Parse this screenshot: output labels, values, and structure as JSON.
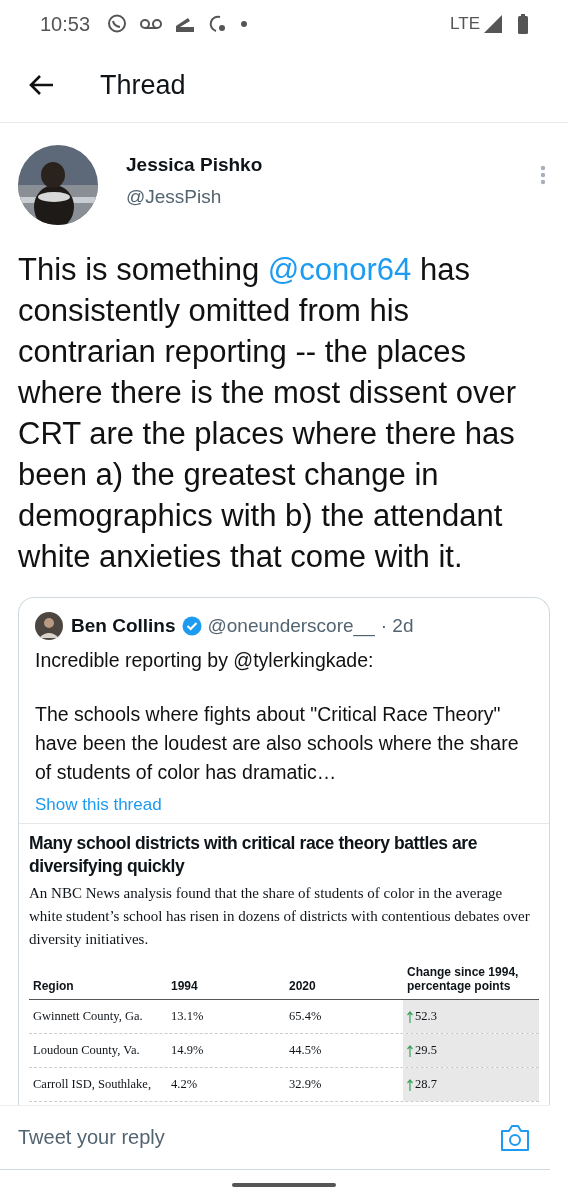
{
  "status_bar": {
    "time": "10:53",
    "network": "LTE"
  },
  "header": {
    "title": "Thread"
  },
  "tweet": {
    "name": "Jessica Pishko",
    "handle": "@JessPish",
    "text": [
      {
        "kind": "plain",
        "text": "This is something "
      },
      {
        "kind": "mention",
        "text": "@conor64"
      },
      {
        "kind": "plain",
        "text": " has consistently omitted from his contrarian reporting -- the places where there is the most dissent over CRT are the places where there has been a) the greatest change in demographics with b) the attendant white anxieties that come with it."
      }
    ],
    "quote": {
      "name": "Ben Collins",
      "verified": true,
      "handle": "@oneunderscore__",
      "time": "· 2d",
      "paragraphs": [
        "Incredible reporting by @tylerkingkade:",
        "The schools where fights about \"Critical Race Theory\" have been the loudest are also schools where the share of students of color has dramatic…"
      ],
      "show_thread": "Show this thread",
      "media": {
        "headline": "Many school districts with critical race theory battles are diversifying quickly",
        "subhead": "An NBC News analysis found that the share of students of color in the average white student’s school has risen in dozens of districts with contentious debates over diversity initiatives.",
        "columns": [
          "Region",
          "1994",
          "2020",
          "Change since 1994, percentage points"
        ],
        "rows": [
          {
            "region": "Gwinnett County, Ga.",
            "y1994": "13.1%",
            "y2020": "65.4%",
            "change": "52.3"
          },
          {
            "region": "Loudoun County, Va.",
            "y1994": "14.9%",
            "y2020": "44.5%",
            "change": "29.5"
          },
          {
            "region": "Carroll ISD, Southlake,",
            "y1994": "4.2%",
            "y2020": "32.9%",
            "change": "28.7"
          }
        ]
      }
    }
  },
  "reply": {
    "placeholder": "Tweet your reply"
  }
}
